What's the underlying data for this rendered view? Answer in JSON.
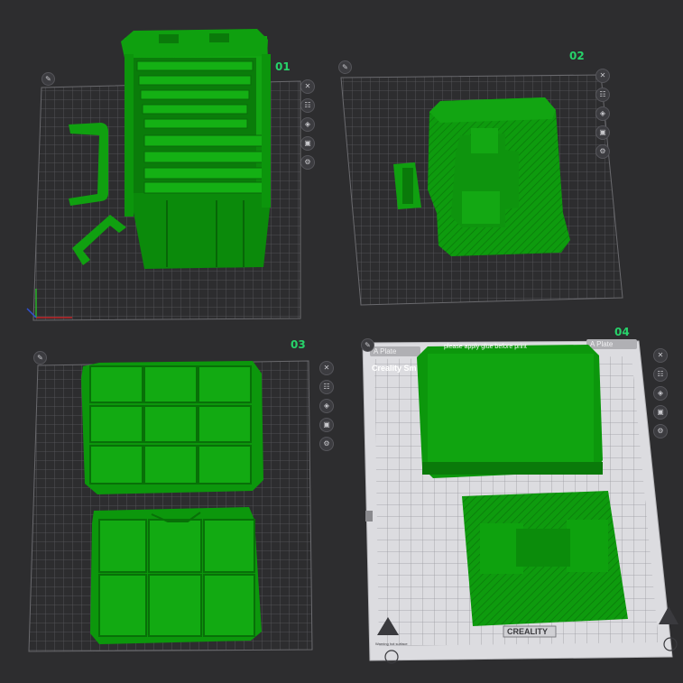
{
  "plates": [
    {
      "label": "01"
    },
    {
      "label": "02"
    },
    {
      "label": "03"
    },
    {
      "label": "04"
    }
  ],
  "plate4": {
    "plate_name_left": "A Plate",
    "plate_name_right": "A Plate",
    "brand_text": "Creality Sm",
    "warning_text": "please apply glue before print",
    "logo_text": "CREALITY",
    "corner_text": "Warning hot surface"
  },
  "toolbar_icons": [
    "close-icon",
    "arrange-icon",
    "orient-icon",
    "lock-icon",
    "settings-icon"
  ],
  "colors": {
    "background": "#2d2d2f",
    "grid": "#5a5a5e",
    "model_green": "#0f9a0f",
    "model_green_dark": "#0a6d0a",
    "label_green": "#27d36a",
    "printer_plate": "#d8d8dc"
  }
}
